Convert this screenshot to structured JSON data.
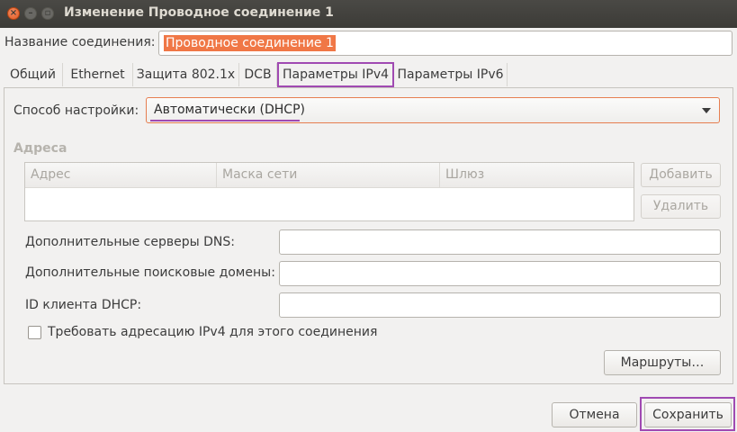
{
  "window": {
    "title": "Изменение Проводное соединение 1",
    "accent_color": "#a04ab2"
  },
  "connection": {
    "name_label": "Название соединения:",
    "name_value": "Проводное соединение 1"
  },
  "tabs": [
    {
      "label": "Общий",
      "active": false
    },
    {
      "label": "Ethernet",
      "active": false
    },
    {
      "label": "Защита 802.1x",
      "active": false
    },
    {
      "label": "DCB",
      "active": false
    },
    {
      "label": "Параметры IPv4",
      "active": true
    },
    {
      "label": "Параметры IPv6",
      "active": false
    }
  ],
  "ipv4": {
    "method_label": "Способ настройки:",
    "method_value": "Автоматически (DHCP)",
    "addresses_title": "Адреса",
    "table_columns": [
      "Адрес",
      "Маска сети",
      "Шлюз"
    ],
    "add_button": "Добавить",
    "delete_button": "Удалить",
    "dns_label": "Дополнительные серверы DNS:",
    "dns_value": "",
    "search_label": "Дополнительные поисковые домены:",
    "search_value": "",
    "dhcp_label": "ID клиента DHCP:",
    "dhcp_value": "",
    "require_label": "Требовать адресацию IPv4 для этого соединения",
    "require_checked": false,
    "routes_button": "Маршруты…"
  },
  "footer": {
    "cancel_button": "Отмена",
    "save_button": "Сохранить"
  }
}
